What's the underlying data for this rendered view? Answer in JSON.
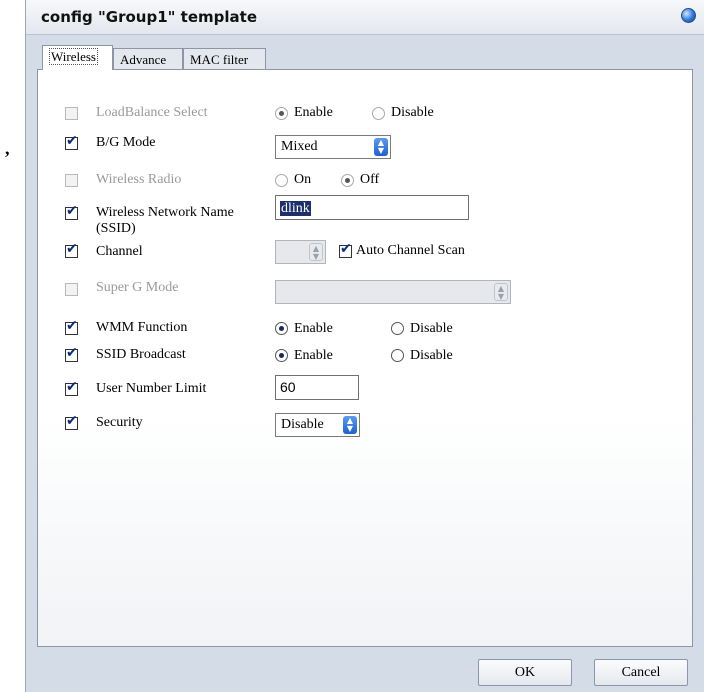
{
  "stray_mark": ",",
  "dialog": {
    "title": "config \"Group1\" template",
    "tabs": [
      {
        "label": "Wireless",
        "active": true
      },
      {
        "label": "Advance",
        "active": false
      },
      {
        "label": "MAC filter",
        "active": false
      }
    ]
  },
  "settings": {
    "load_balance": {
      "label": "LoadBalance Select",
      "enabled": false,
      "options": [
        "Enable",
        "Disable"
      ],
      "selected": "Enable"
    },
    "bg_mode": {
      "label": "B/G Mode",
      "checked": true,
      "value": "Mixed"
    },
    "wireless_radio": {
      "label": "Wireless Radio",
      "enabled": false,
      "options": [
        "On",
        "Off"
      ],
      "selected": "Off"
    },
    "ssid": {
      "label_line1": "Wireless Network Name",
      "label_line2": "(SSID)",
      "checked": true,
      "value": "dlink"
    },
    "channel": {
      "label": "Channel",
      "checked": true,
      "value": "",
      "auto_scan_label": "Auto Channel Scan",
      "auto_scan_checked": true
    },
    "super_g": {
      "label": "Super G Mode",
      "enabled": false,
      "value": ""
    },
    "wmm": {
      "label": "WMM Function",
      "checked": true,
      "options": [
        "Enable",
        "Disable"
      ],
      "selected": "Enable"
    },
    "ssid_broadcast": {
      "label": "SSID Broadcast",
      "checked": true,
      "options": [
        "Enable",
        "Disable"
      ],
      "selected": "Enable"
    },
    "user_limit": {
      "label": "User Number Limit",
      "checked": true,
      "value": "60"
    },
    "security": {
      "label": "Security",
      "checked": true,
      "value": "Disable"
    }
  },
  "buttons": {
    "ok": "OK",
    "cancel": "Cancel"
  }
}
